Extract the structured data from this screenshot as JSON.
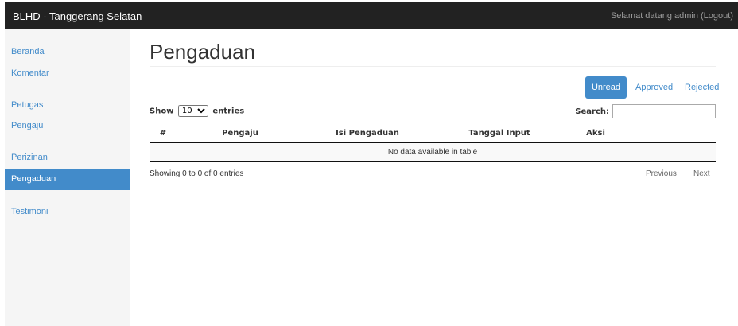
{
  "navbar": {
    "brand": "BLHD - Tanggerang Selatan",
    "welcome": "Selamat datang admin (Logout)"
  },
  "sidebar": {
    "items": [
      {
        "label": "Beranda",
        "active": false
      },
      {
        "label": "Komentar",
        "active": false
      },
      {
        "label": "Petugas",
        "active": false
      },
      {
        "label": "Pengaju",
        "active": false
      },
      {
        "label": "Perizinan",
        "active": false
      },
      {
        "label": "Pengaduan",
        "active": true
      },
      {
        "label": "Testimoni",
        "active": false
      }
    ]
  },
  "main": {
    "title": "Pengaduan",
    "tabs": [
      {
        "label": "Unread",
        "active": true
      },
      {
        "label": "Approved",
        "active": false
      },
      {
        "label": "Rejected",
        "active": false
      }
    ],
    "length": {
      "prefix": "Show",
      "value": "10",
      "suffix": "entries"
    },
    "search": {
      "label": "Search:",
      "value": ""
    },
    "table": {
      "columns": [
        "#",
        "Pengaju",
        "Isi Pengaduan",
        "Tanggal Input",
        "Aksi"
      ],
      "empty": "No data available in table"
    },
    "info": "Showing 0 to 0 of 0 entries",
    "pager": {
      "previous": "Previous",
      "next": "Next"
    }
  },
  "colors": {
    "navbar": "#222222",
    "accent": "#428bca",
    "sidebar": "#f5f5f5"
  }
}
